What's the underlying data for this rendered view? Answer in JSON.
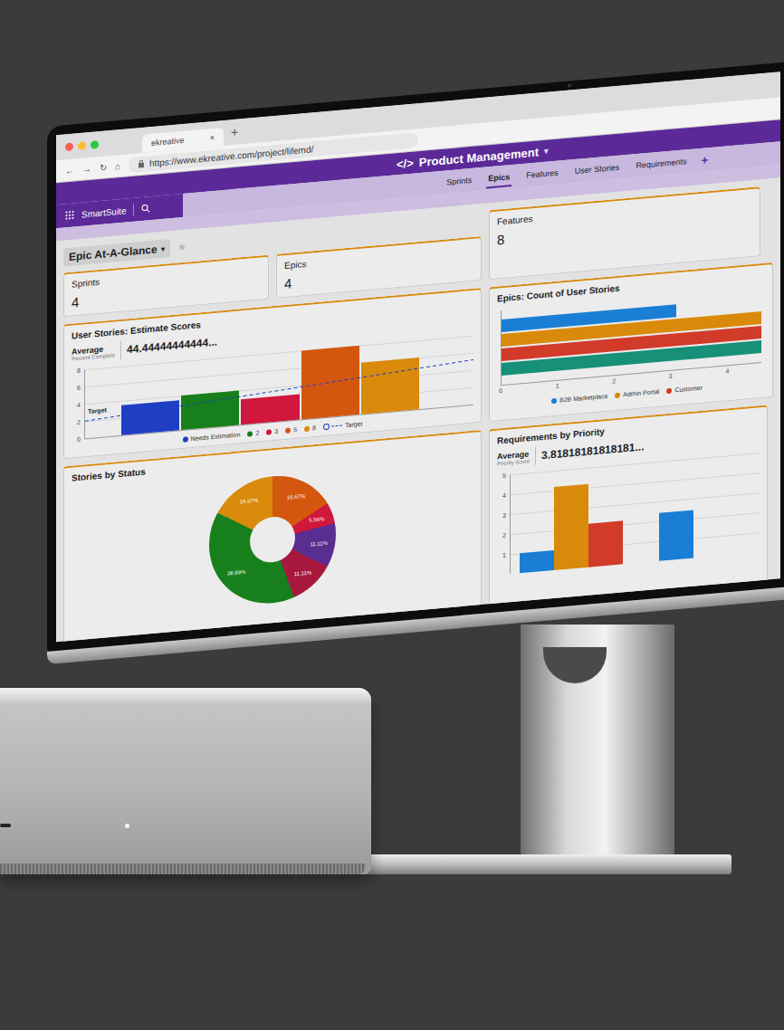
{
  "browser": {
    "tab_title": "ekreative",
    "tab_close": "×",
    "new_tab": "+",
    "nav": [
      "←",
      "→",
      "↻",
      "⌂"
    ],
    "url": "https://www.ekreative.com/project/lifemd/"
  },
  "app": {
    "logo": "SmartSuite",
    "title_icon": "</>",
    "title": "Product Management",
    "title_caret": "▾",
    "tabs": [
      {
        "label": "Sprints",
        "selected": false
      },
      {
        "label": "Epics",
        "selected": true
      },
      {
        "label": "Features",
        "selected": false
      },
      {
        "label": "User Stories",
        "selected": false
      },
      {
        "label": "Requirements",
        "selected": false
      }
    ],
    "add": "+"
  },
  "dashboard": {
    "title": "Epic At-A-Glance",
    "caret": "▾",
    "star": "★"
  },
  "stats": [
    {
      "label": "Sprints",
      "value": "4"
    },
    {
      "label": "Epics",
      "value": "4"
    },
    {
      "label": "Features",
      "value": "8"
    }
  ],
  "estimate_chart": {
    "title": "User Stories: Estimate Scores",
    "average_label": "Average",
    "average_sub": "Percent Complete",
    "average_value": "44.44444444444...",
    "y_ticks": [
      "0",
      "2",
      "4",
      "6",
      "8"
    ],
    "y_max": 8,
    "bars": [
      {
        "value": 3.5,
        "color": "#1e3fc4"
      },
      {
        "value": 4,
        "color": "#17801c"
      },
      {
        "value": 3,
        "color": "#d0173c"
      },
      {
        "value": 8,
        "color": "#d4570f"
      },
      {
        "value": 6,
        "color": "#d98a0a"
      }
    ],
    "target": {
      "label": "Target",
      "values": [
        2,
        5.2
      ]
    },
    "legend": [
      {
        "label": "Needs Estimation",
        "color": "#1e3fc4",
        "kind": "dot"
      },
      {
        "label": "2",
        "color": "#17801c",
        "kind": "dot"
      },
      {
        "label": "3",
        "color": "#d0173c",
        "kind": "dot"
      },
      {
        "label": "5",
        "color": "#d4570f",
        "kind": "dot"
      },
      {
        "label": "8",
        "color": "#d98a0a",
        "kind": "dot"
      },
      {
        "label": "Target",
        "color": "#1e3fc4",
        "kind": "line"
      }
    ]
  },
  "epics_chart": {
    "title": "Epics: Count of User Stories",
    "x_ticks": [
      "0",
      "1",
      "2",
      "3",
      "4"
    ],
    "x_max": 4.6,
    "bars": [
      {
        "value": 3.1,
        "color": "#1a7fd4"
      },
      {
        "value": 4.6,
        "color": "#d98a0a"
      },
      {
        "value": 4.6,
        "color": "#d23a2a"
      },
      {
        "value": 4.6,
        "color": "#179078"
      }
    ],
    "legend": [
      {
        "label": "B2B Marketplace",
        "color": "#1a7fd4"
      },
      {
        "label": "Admin Portal",
        "color": "#d98a0a"
      },
      {
        "label": "Customer",
        "color": "#d23a2a"
      }
    ]
  },
  "status_chart": {
    "title": "Stories by Status",
    "slices": [
      {
        "label": "16.67%",
        "value": 16.67,
        "color": "#d4570f"
      },
      {
        "label": "5.56%",
        "value": 5.56,
        "color": "#d0173c"
      },
      {
        "label": "11.11%",
        "value": 11.11,
        "color": "#5a2d91"
      },
      {
        "label": "11.11%",
        "value": 11.11,
        "color": "#a8183e"
      },
      {
        "label": "38.89%",
        "value": 38.89,
        "color": "#17801c"
      },
      {
        "label": "16.67%",
        "value": 16.67,
        "color": "#d98a0a"
      }
    ]
  },
  "priority_chart": {
    "title": "Requirements by Priority",
    "average_label": "Average",
    "average_sub": "Priority Score",
    "average_value": "3.81818181818181...",
    "y_ticks": [
      "1",
      "2",
      "3",
      "4",
      "5"
    ],
    "y_max": 5,
    "groups": [
      {
        "bars": [
          {
            "value": 1,
            "color": "#1a7fd4"
          },
          {
            "value": 4.2,
            "color": "#d98a0a"
          },
          {
            "value": 2.2,
            "color": "#d23a2a"
          }
        ]
      },
      {
        "bars": [
          {
            "value": 2.4,
            "color": "#1a7fd4"
          }
        ]
      }
    ]
  }
}
